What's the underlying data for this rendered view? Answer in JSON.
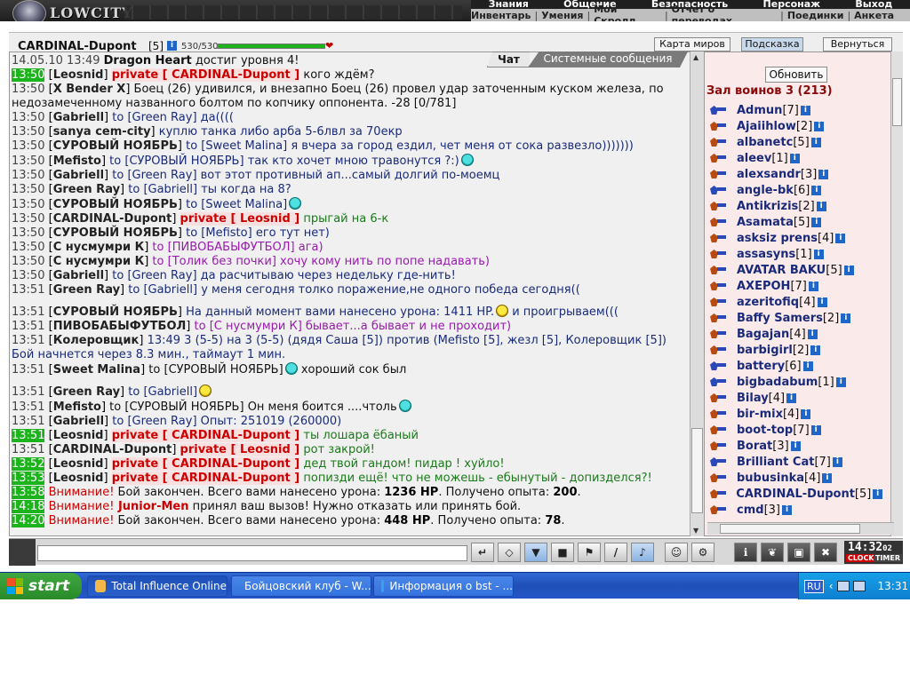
{
  "app": {
    "logo_text": "LOWCITY",
    "top_menu": [
      "Знания",
      "Общение",
      "Безопасность",
      "Персонаж",
      "Выход"
    ],
    "sub_menu": [
      "Инвентарь",
      "Умения",
      "Мой Скролл",
      "Отчет о переводах",
      "Поединки",
      "Анкета"
    ]
  },
  "character": {
    "name": "CARDINAL-Dupont",
    "level": "[5]",
    "info_badge": "i",
    "hp_text": "530/530",
    "hp_fraction": 1.0
  },
  "top_buttons": {
    "map": "Карта миров",
    "hint": "Подсказка",
    "back": "Вернуться"
  },
  "tabs": {
    "chat": "Чат",
    "system": "Системные сообщения"
  },
  "chat_lines": [
    {
      "time": "14.05.10 13:49",
      "name": "Dragon Heart",
      "text": " достиг уровня 4!"
    },
    {
      "time": "13:50",
      "hl": true,
      "sender": "Leosnid",
      "priv": "private [ CARDINAL-Dupont ]",
      "text": " кого ждём?"
    },
    {
      "time": "13:50",
      "sender": "X Bender X",
      "text": " Боец (26) удивился, и внезапно Боец (26) провел удар заточенным куском железа, по недозамеченному названного болтом по копчику оппонента. -28 [0/781]",
      "color": "black"
    },
    {
      "time": "13:50",
      "sender": "Gabriell",
      "to": "Green Ray",
      "text": " да((((",
      "color": "navy"
    },
    {
      "time": "13:50",
      "sender": "sanya cem-city",
      "text": " куплю танка либо арба 5-6лвл за 70екр",
      "color": "navy"
    },
    {
      "time": "13:50",
      "sender": "СУРОВЫЙ НОЯБРЬ",
      "to": "Sweet Malina",
      "text": " я вчера за город ездил, чет меня от сока развезло)))))))",
      "color": "navy"
    },
    {
      "time": "13:50",
      "sender": "Mefisto",
      "to": "СУРОВЫЙ НОЯБРЬ",
      "text": " так кто хочет мною травонутся ?:)",
      "color": "navy",
      "smile": "c"
    },
    {
      "time": "13:50",
      "sender": "Gabriell",
      "to": "Green Ray",
      "text": " вот этот противный ап...самый долгий по-моемц",
      "color": "navy"
    },
    {
      "time": "13:50",
      "sender": "Green Ray",
      "to": "Gabriell",
      "text": " ты когда на 8?",
      "color": "navy"
    },
    {
      "time": "13:50",
      "sender": "СУРОВЫЙ НОЯБРЬ",
      "to": "Sweet Malina",
      "text": "",
      "color": "navy",
      "smile": "c"
    },
    {
      "time": "13:50",
      "sender": "CARDINAL-Dupont",
      "priv": "private [ Leosnid ]",
      "text": " прыгай на 6-к",
      "color": "green"
    },
    {
      "time": "13:50",
      "sender": "СУРОВЫЙ НОЯБРЬ",
      "to": "Mefisto",
      "text": " его тут нет)",
      "color": "navy"
    },
    {
      "time": "13:50",
      "sender": "С нусмумри К",
      "to": "ПИВОБАБЫФУТБОЛ",
      "text": " ага)",
      "color": "purple"
    },
    {
      "time": "13:50",
      "sender": "С нусмумри К",
      "to": "Толик без почки",
      "text": " хочу кому нить по попе надавать)",
      "color": "purple"
    },
    {
      "time": "13:50",
      "sender": "Gabriell",
      "to": "Green Ray",
      "text": " да расчитываю через недельку где-нить!",
      "color": "navy"
    },
    {
      "time": "13:51",
      "sender": "Green Ray",
      "to": "Gabriell",
      "text": " у меня сегодня толко поражение,не одного победа сегодня((",
      "color": "navy"
    },
    {
      "time": "13:51",
      "sender": "СУРОВЫЙ НОЯБРЬ",
      "text": " На данный момент вами нанесено урона: 1411 HP.",
      "tail": " и проигрываем(((",
      "color": "navy",
      "smile_mid": "y",
      "gap": true
    },
    {
      "time": "13:51",
      "sender": "ПИВОБАБЫФУТБОЛ",
      "to": "С нусмумри К",
      "text": " бывает...а бывает и не проходит)",
      "color": "purple"
    },
    {
      "time": "13:51",
      "sender": "Колеровщик",
      "text": " 13:49 3 (5-5) на 3 (5-5) (дядя Саша [5]) против (Mefisto [5], жезл [5], Колеровщик [5]) Бой начнется через 8.3 мин., таймаут 1 мин.",
      "color": "navy"
    },
    {
      "time": "13:51",
      "sender": "Sweet Malina",
      "to": "СУРОВЫЙ НОЯБРЬ",
      "text": " хороший сок был",
      "color": "black",
      "smile_pre": "c"
    },
    {
      "time": "13:51",
      "sender": "Green Ray",
      "to": "Gabriell",
      "text": "",
      "color": "navy",
      "smile": "y",
      "gap": true
    },
    {
      "time": "13:51",
      "sender": "Mefisto",
      "to": "СУРОВЫЙ НОЯБРЬ",
      "text": " Он меня боится ....чтоль",
      "color": "black",
      "smile": "c"
    },
    {
      "time": "13:51",
      "sender": "Gabriell",
      "to": "Green Ray",
      "text": " Опыт: 251019 (260000)",
      "color": "navy"
    },
    {
      "time": "13:51",
      "hl": true,
      "sender": "Leosnid",
      "priv": "private [ CARDINAL-Dupont ]",
      "text": " ты лошара ёбаный",
      "color": "green"
    },
    {
      "time": "13:51",
      "sender": "CARDINAL-Dupont",
      "priv": "private [ Leosnid ]",
      "text": " рот закрой!",
      "color": "green"
    },
    {
      "time": "13:52",
      "hl": true,
      "sender": "Leosnid",
      "priv": "private [ CARDINAL-Dupont ]",
      "text": " дед твой гандом! пидар ! хуйло!",
      "color": "green"
    },
    {
      "time": "13:53",
      "hl": true,
      "sender": "Leosnid",
      "priv": "private [ CARDINAL-Dupont ]",
      "text": " попизди ещё! что не можешь - ебынутый - допизделся?!",
      "color": "green"
    },
    {
      "time": "13:58",
      "hl": true,
      "system": "Внимание!",
      "text": " Бой закончен. Всего вами нанесено урона: ",
      "b1": "1236 HP",
      "mid": ". Получено опыта: ",
      "b2": "200",
      "end": "."
    },
    {
      "time": "14:18",
      "hl": true,
      "system": "Внимание!",
      "red_name": "Junior-Men",
      "text": " принял ваш вызов! Нужно отказать или принять бой."
    },
    {
      "time": "14:20",
      "hl": true,
      "system": "Внимание!",
      "text": " Бой закончен. Всего вами нанесено урона: ",
      "b1": "448 HP",
      "mid": ". Получено опыта: ",
      "b2": "78",
      "end": "."
    }
  ],
  "roster": {
    "refresh_label": "Обновить",
    "room_title": "Зал воинов 3 (213)",
    "users": [
      {
        "name": "Admun",
        "lvl": "[7]",
        "alt": true
      },
      {
        "name": "Ajaiihlow",
        "lvl": "[2]"
      },
      {
        "name": "albanetc",
        "lvl": "[5]"
      },
      {
        "name": "aleev",
        "lvl": "[1]"
      },
      {
        "name": "alexsandr",
        "lvl": "[3]"
      },
      {
        "name": "angle-bk",
        "lvl": "[6]",
        "alt": true
      },
      {
        "name": "Antikrizis",
        "lvl": "[2]"
      },
      {
        "name": "Asamata",
        "lvl": "[5]"
      },
      {
        "name": "asksiz prens",
        "lvl": "[4]"
      },
      {
        "name": "assasyns",
        "lvl": "[1]"
      },
      {
        "name": "AVATAR BAKU",
        "lvl": "[5]"
      },
      {
        "name": "AXEPOH",
        "lvl": "[7]"
      },
      {
        "name": "azeritofiq",
        "lvl": "[4]"
      },
      {
        "name": "Baffy Samers",
        "lvl": "[2]"
      },
      {
        "name": "Bagajan",
        "lvl": "[4]"
      },
      {
        "name": "barbigirl",
        "lvl": "[2]"
      },
      {
        "name": "battery",
        "lvl": "[6]",
        "alt": true
      },
      {
        "name": "bigbadabum",
        "lvl": "[1]",
        "alt": true
      },
      {
        "name": "Bilay",
        "lvl": "[4]"
      },
      {
        "name": "bir-mix",
        "lvl": "[4]"
      },
      {
        "name": "boot-top",
        "lvl": "[7]"
      },
      {
        "name": "Borat",
        "lvl": "[3]"
      },
      {
        "name": "Brilliant Cat",
        "lvl": "[7]",
        "alt": true
      },
      {
        "name": "bubusinka",
        "lvl": "[4]"
      },
      {
        "name": "CARDINAL-Dupont",
        "lvl": "[5]"
      },
      {
        "name": "cmd",
        "lvl": "[3]"
      }
    ]
  },
  "bottom": {
    "clock": "14:32",
    "clock_sec": "02",
    "clock_label": "CLOCK",
    "timer_label": "TIMER",
    "tool_icons": [
      "enter-icon",
      "eraser-icon",
      "filter-icon",
      "save-icon",
      "walk-icon",
      "slash-icon",
      "music-icon",
      "smiley-icon",
      "emblem-icon",
      "info-icon",
      "pet-icon",
      "lock-icon",
      "exit-icon"
    ]
  },
  "taskbar": {
    "start": "start",
    "tasks": [
      "Total Influence Online",
      "Бойцовский клуб - W...",
      "Информация о bst - ..."
    ],
    "lang": "RU",
    "time": "13:31"
  }
}
